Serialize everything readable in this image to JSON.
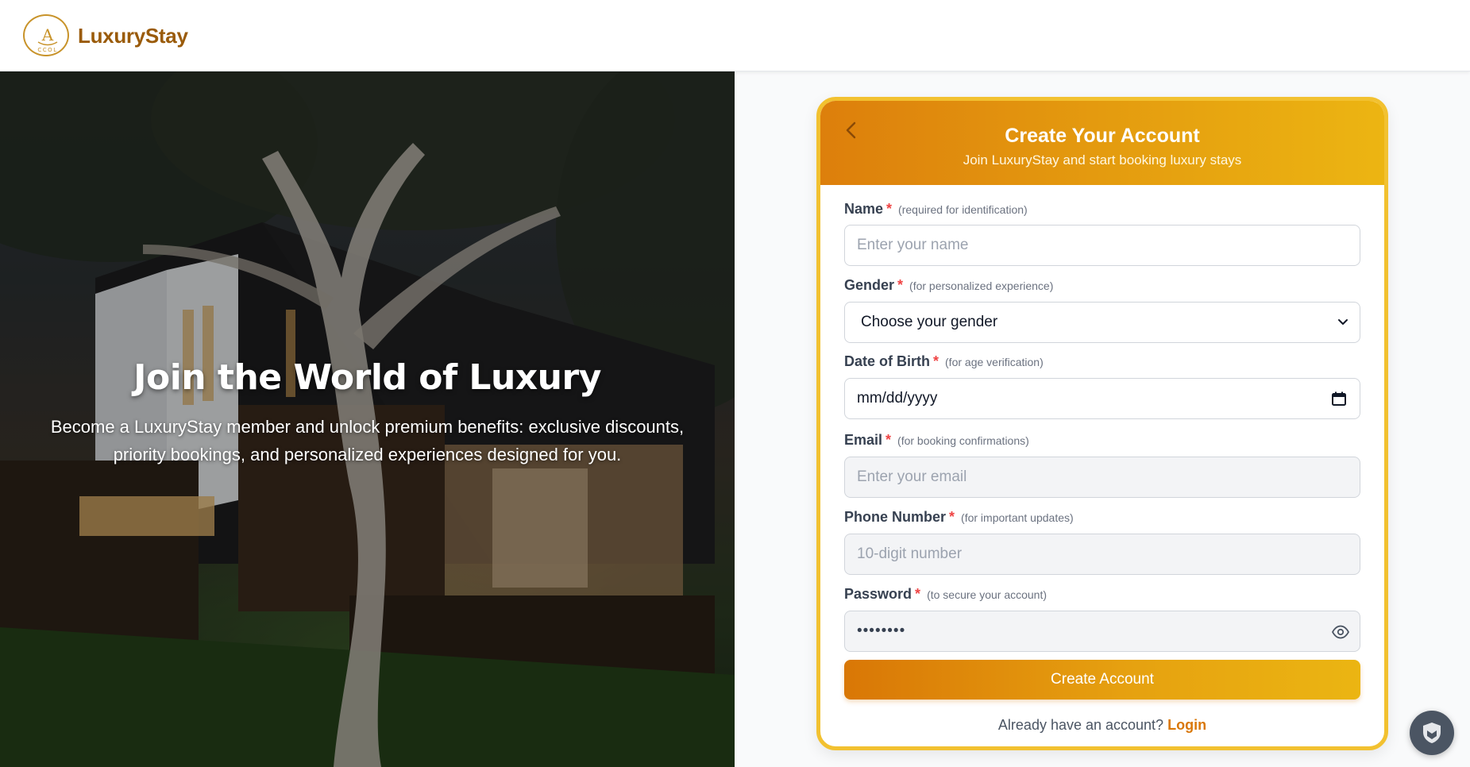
{
  "header": {
    "brand": "LuxuryStay",
    "logo_icon": "luxurystay-crest-logo",
    "logo_mark_letters": "A",
    "logo_sub_letters": "CCOL"
  },
  "hero": {
    "title": "Join the World of Luxury",
    "text": "Become a LuxuryStay member and unlock premium benefits: exclusive discounts, priority bookings, and personalized experiences designed for you.",
    "image": "modern-house-with-tree-at-dusk"
  },
  "form": {
    "title": "Create Your Account",
    "subtitle": "Join LuxuryStay and start booking luxury stays",
    "back_icon": "chevron-left-icon",
    "required_mark": "*",
    "fields": {
      "name": {
        "label": "Name",
        "hint": "(required for identification)",
        "placeholder": "Enter your name",
        "value": ""
      },
      "gender": {
        "label": "Gender",
        "hint": "(for personalized experience)",
        "selected": "Choose your gender"
      },
      "dob": {
        "label": "Date of Birth",
        "hint": "(for age verification)",
        "placeholder": "mm/dd/yyyy"
      },
      "email": {
        "label": "Email",
        "hint": "(for booking confirmations)",
        "placeholder": "Enter your email",
        "value": ""
      },
      "phone": {
        "label": "Phone Number",
        "hint": "(for important updates)",
        "placeholder": "10-digit number",
        "value": ""
      },
      "password": {
        "label": "Password",
        "hint": "(to secure your account)",
        "masked_value": "••••••••"
      }
    },
    "submit_label": "Create Account",
    "login_prompt": "Already have an account?",
    "login_link": "Login"
  },
  "colors": {
    "brand": "#9a5b0a",
    "accent_start": "#d97706",
    "accent_end": "#ebb512",
    "card_border": "#f2c130",
    "required": "#ef4444"
  },
  "widget": {
    "icon": "shield-check-icon"
  }
}
